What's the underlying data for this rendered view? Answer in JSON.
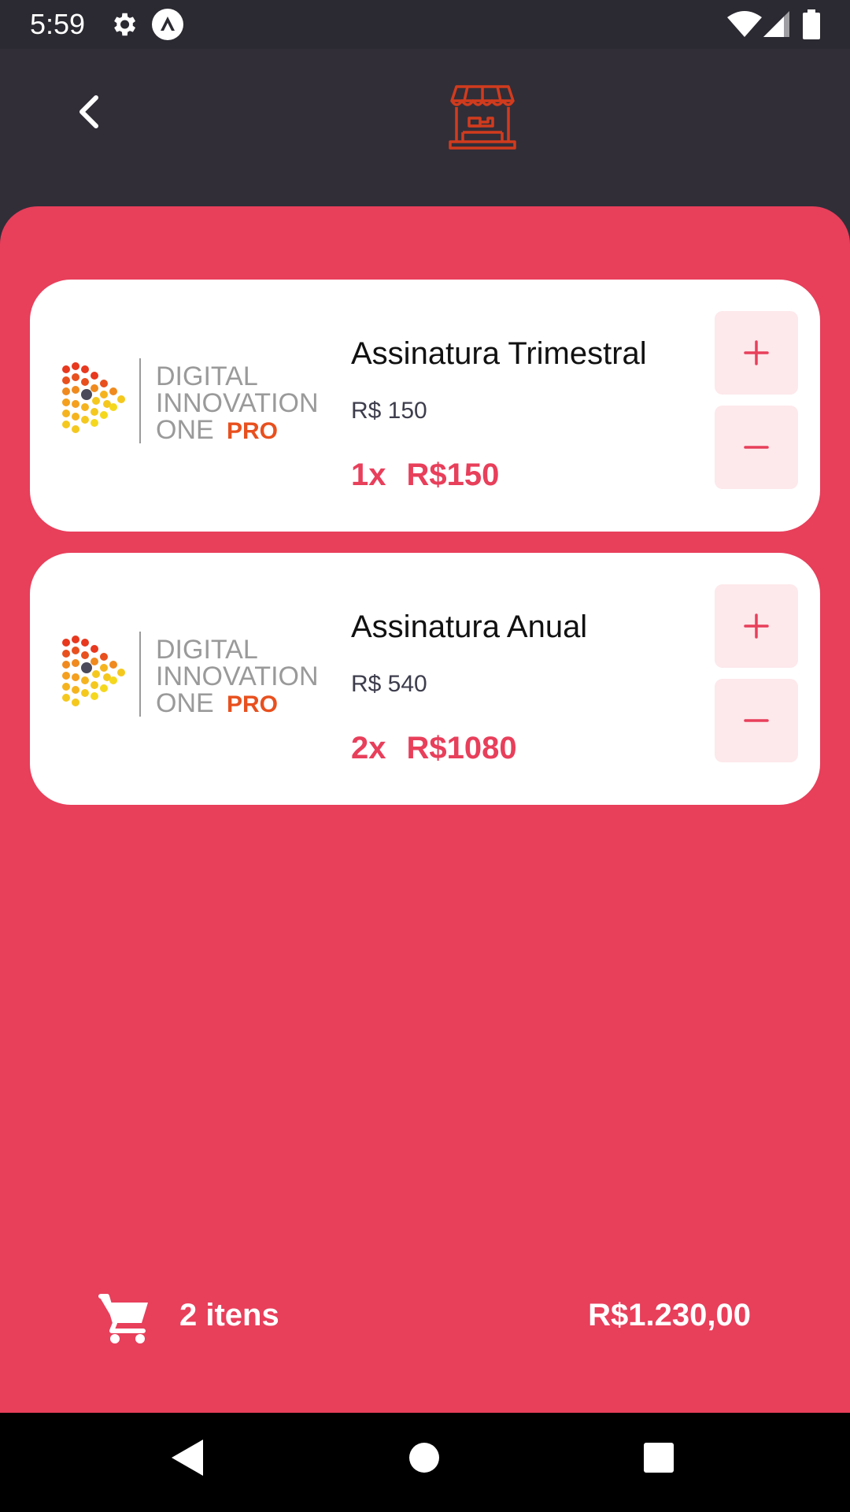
{
  "status_bar": {
    "time": "5:59",
    "icons": [
      "settings-icon",
      "app-notification-icon",
      "wifi-icon",
      "cellular-signal-icon",
      "battery-icon"
    ]
  },
  "header": {
    "back_icon": "chevron-left-icon",
    "logo_icon": "store-icon",
    "logo_color": "#d13b1d"
  },
  "products": [
    {
      "logo": {
        "line1": "DIGITAL",
        "line2": "INNOVATION",
        "line3": "ONE",
        "badge": "PRO"
      },
      "title": "Assinatura Trimestral",
      "price": "R$ 150",
      "quantity": "1x",
      "subtotal": "R$150",
      "add_icon": "plus-icon",
      "remove_icon": "minus-icon"
    },
    {
      "logo": {
        "line1": "DIGITAL",
        "line2": "INNOVATION",
        "line3": "ONE",
        "badge": "PRO"
      },
      "title": "Assinatura Anual",
      "price": "R$ 540",
      "quantity": "2x",
      "subtotal": "R$1080",
      "add_icon": "plus-icon",
      "remove_icon": "minus-icon"
    }
  ],
  "cart": {
    "icon": "shopping-cart-icon",
    "items_label": "2 itens",
    "total": "R$1.230,00"
  },
  "navigation": {
    "icons": [
      "back-triangle-icon",
      "home-circle-icon",
      "recents-square-icon"
    ]
  },
  "colors": {
    "accent": "#e83f5b",
    "header_bg": "#312e38",
    "card_bg": "#ffffff",
    "button_bg": "#fde8eb",
    "logo_orange": "#e8501e",
    "logo_gray": "#9a9a9a"
  }
}
